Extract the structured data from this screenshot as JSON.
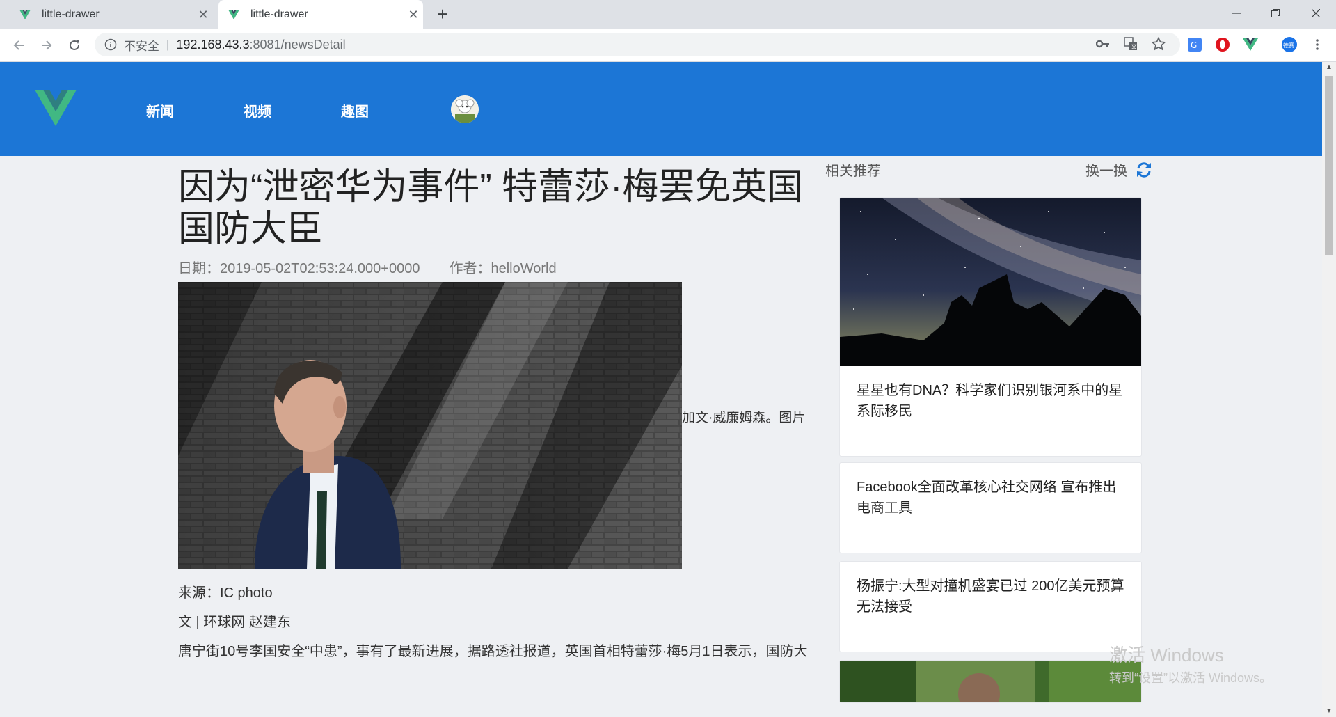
{
  "browser": {
    "tabs": [
      {
        "title": "little-drawer",
        "active": false
      },
      {
        "title": "little-drawer",
        "active": true
      }
    ],
    "address": {
      "security_label": "不安全",
      "separator": "|",
      "host": "192.168.43.3",
      "path": ":8081/newsDetail"
    },
    "extension_badge": "德赛"
  },
  "site": {
    "nav": [
      {
        "label": "新闻"
      },
      {
        "label": "视频"
      },
      {
        "label": "趣图"
      }
    ],
    "colors": {
      "header": "#1c76d6",
      "logo_green": "#41b883",
      "logo_dark": "#35495e"
    }
  },
  "article": {
    "title": "因为“泄密华为事件” 特蕾莎·梅罢免英国国防大臣",
    "date_label": "日期：2019-05-02T02:53:24.000+0000",
    "author_label": "作者：helloWorld",
    "caption_fragment": "加文·威廉姆森。图片",
    "source": "来源：IC photo",
    "byline": "文 | 环球网 赵建东",
    "first_line": "唐宁街10号李国安全“中患”，事有了最新进展，据路透社报道，英国首相特蕾莎·梅5月1日表示，国防大"
  },
  "sidebar": {
    "title": "相关推荐",
    "refresh_label": "换一换",
    "items": [
      {
        "text": "星星也有DNA？科学家们识别银河系中的星系际移民",
        "has_image": true
      },
      {
        "text": "Facebook全面改革核心社交网络 宣布推出电商工具",
        "has_image": false
      },
      {
        "text": "杨振宁:大型对撞机盛宴已过 200亿美元预算无法接受",
        "has_image": false
      }
    ]
  },
  "watermark": {
    "line1": "激活 Windows",
    "line2": "转到“设置”以激活 Windows。"
  }
}
